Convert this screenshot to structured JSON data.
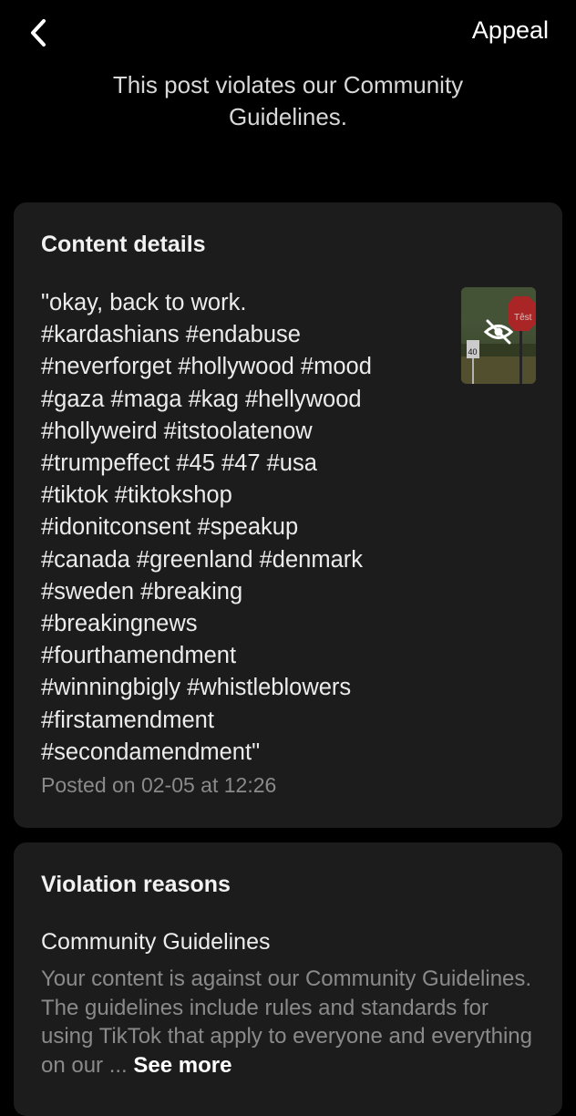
{
  "header": {
    "back_icon": "chevron-left-icon",
    "appeal_label": "Appeal",
    "headline": "This post violates our Community Guidelines."
  },
  "content_details": {
    "title": "Content details",
    "caption": "\"okay, back to work.\n#kardashians #endabuse\n#neverforget #hollywood #mood\n#gaza #maga #kag #hellywood\n#hollyweird #itstoolatenow\n#trumpeffect #45 #47 #usa\n#tiktok #tiktokshop\n#idonitconsent #speakup\n#canada #greenland #denmark\n#sweden #breaking\n#breakingnews\n#fourthamendment\n#winningbigly #whistleblowers\n#firstamendment\n#secondamendment\"",
    "posted": "Posted on 02-05 at 12:26",
    "thumbnail": {
      "hidden_icon": "eye-slash-icon",
      "sign_text": "Têst",
      "speed_sign_text": "40"
    }
  },
  "violation_reasons": {
    "title": "Violation reasons",
    "reason_heading": "Community Guidelines",
    "reason_text": "Your content is against our Community Guidelines. The guidelines include rules and standards for using TikTok that apply to everyone and everything on our ...",
    "see_more_label": "See more"
  },
  "colors": {
    "background": "#000000",
    "card": "#1c1c1c",
    "muted_text": "#8a8a8a"
  }
}
